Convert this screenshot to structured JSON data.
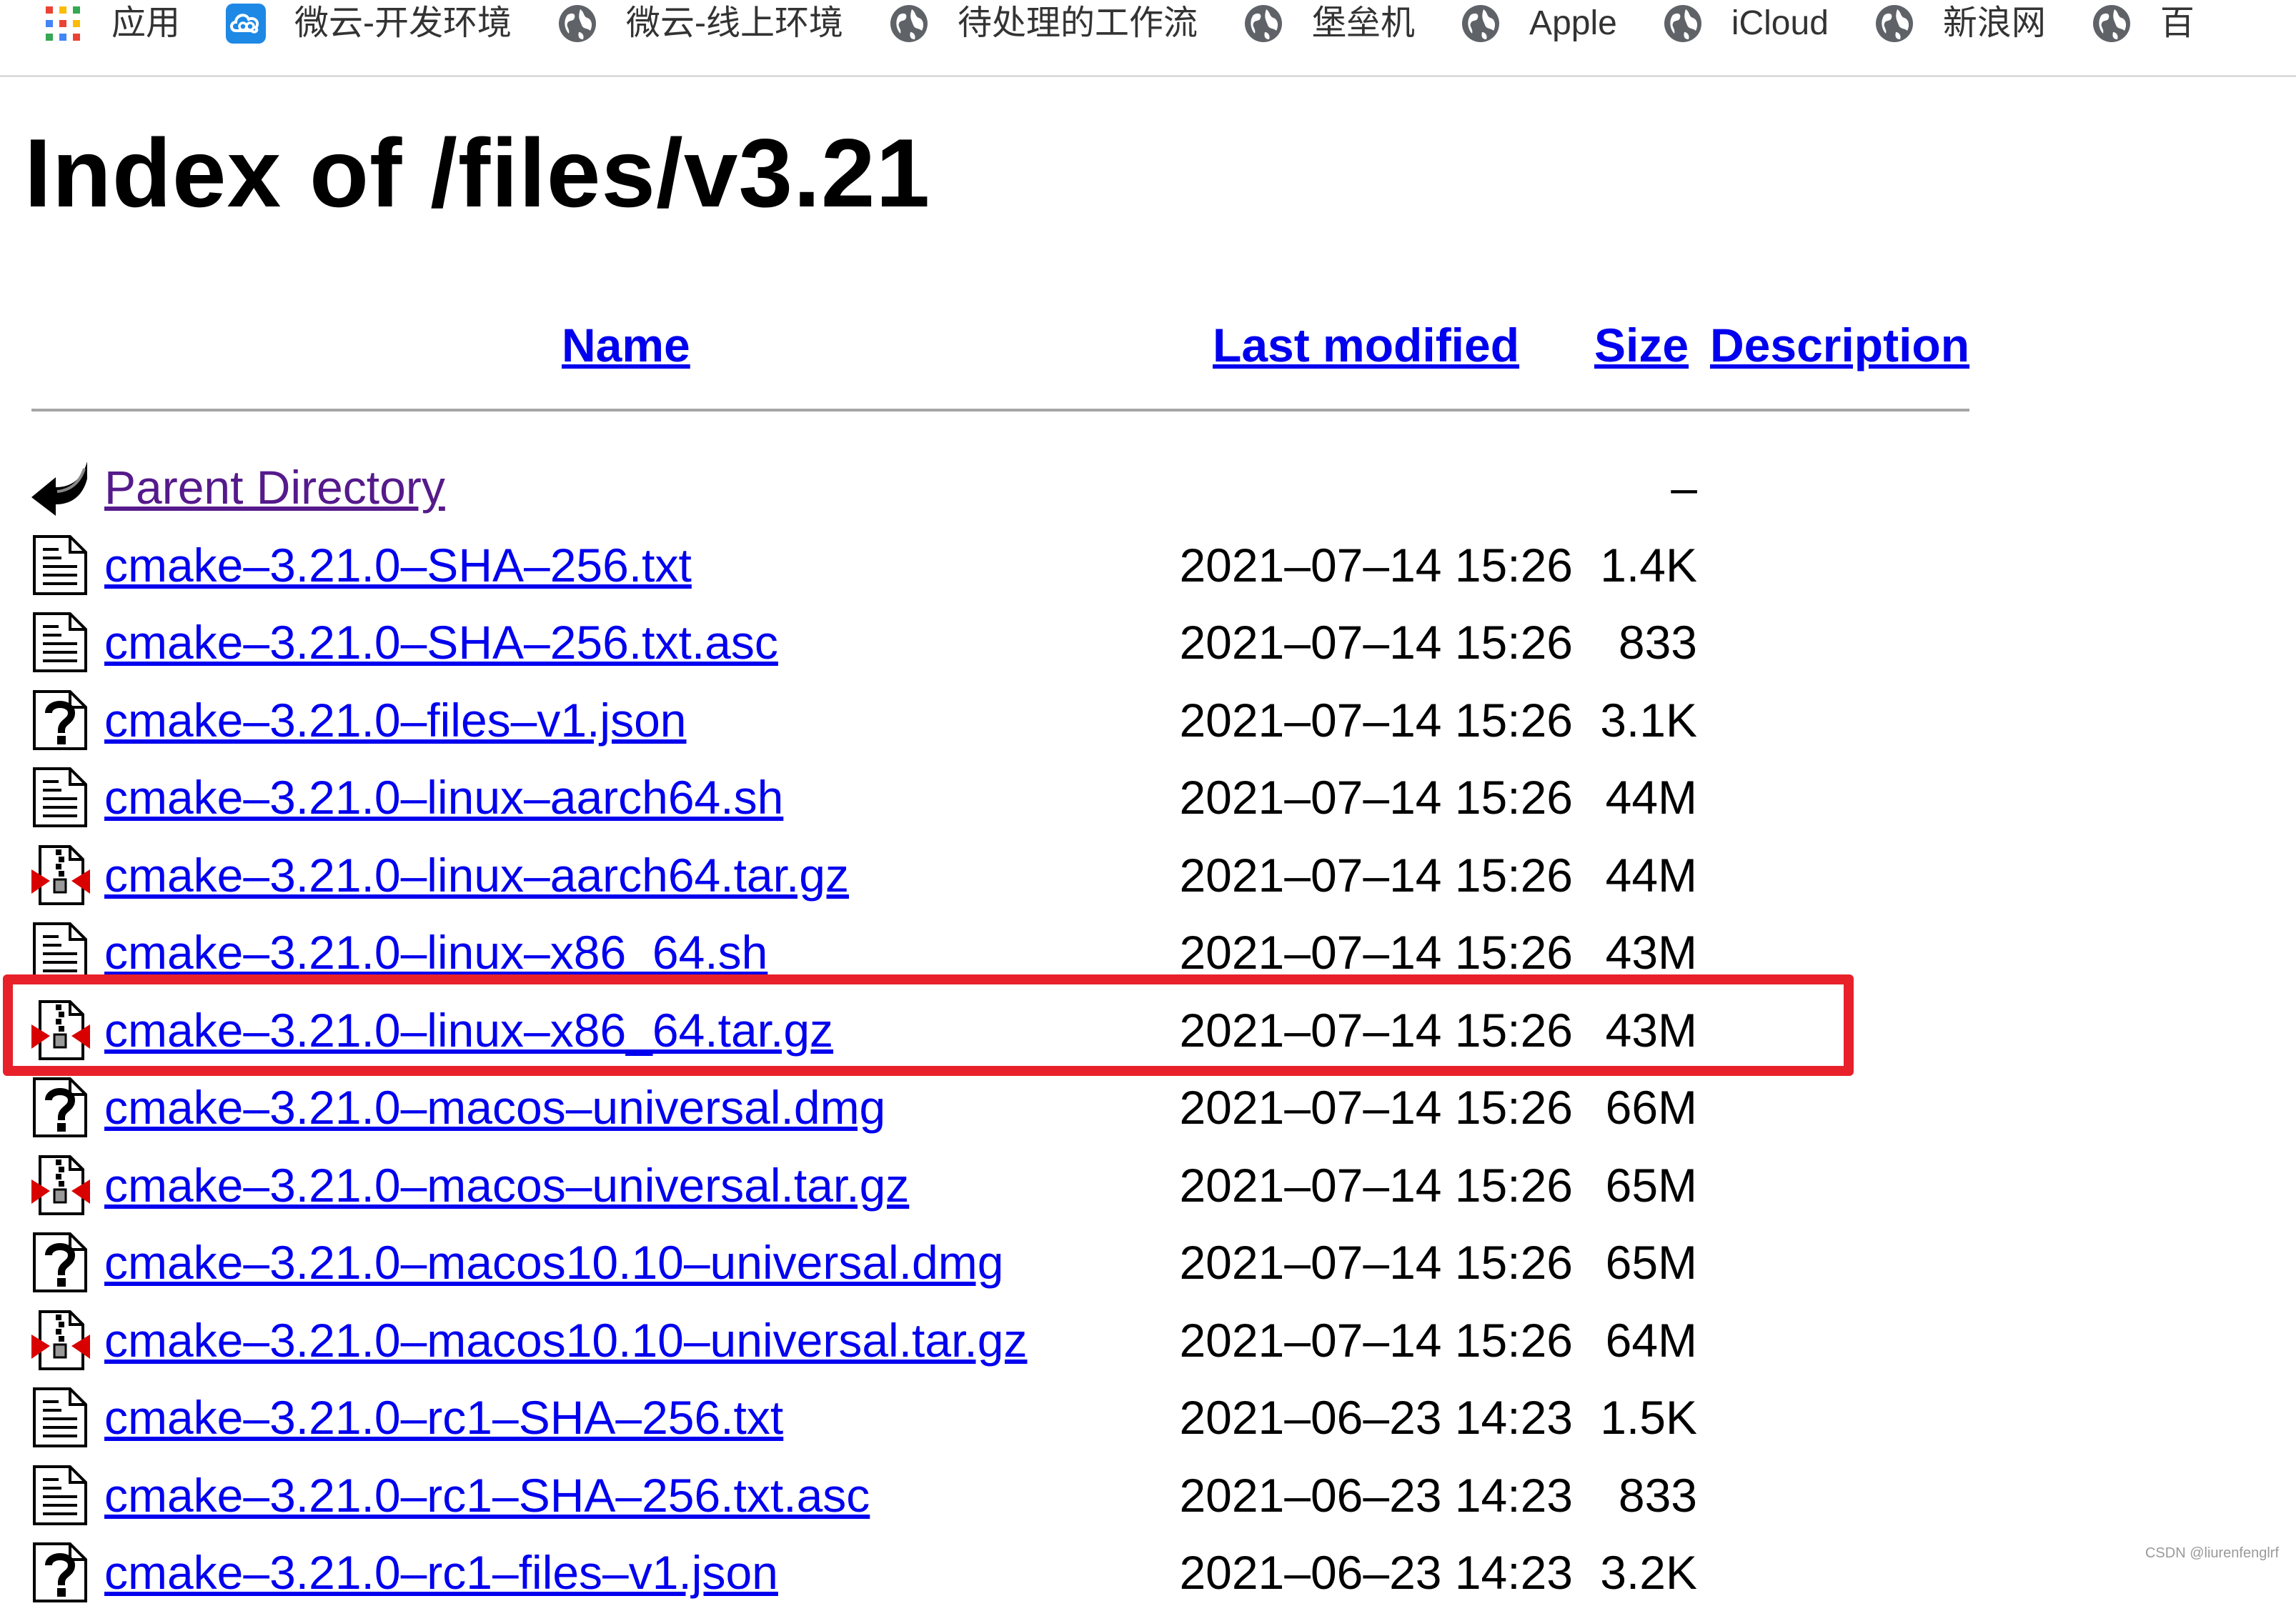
{
  "bookmarks": [
    {
      "label": "应用",
      "icon": "apps-grid-icon"
    },
    {
      "label": "微云-开发环境",
      "icon": "weiyun-cloud-icon"
    },
    {
      "label": "微云-线上环境",
      "icon": "globe-icon"
    },
    {
      "label": "待处理的工作流",
      "icon": "globe-icon"
    },
    {
      "label": "堡垒机",
      "icon": "globe-icon"
    },
    {
      "label": "Apple",
      "icon": "globe-icon"
    },
    {
      "label": "iCloud",
      "icon": "globe-icon"
    },
    {
      "label": "新浪网",
      "icon": "globe-icon"
    },
    {
      "label": "百",
      "icon": "globe-icon"
    }
  ],
  "page": {
    "title": "Index of /files/v3.21"
  },
  "columns": {
    "name": "Name",
    "last_modified": "Last modified",
    "size": "Size",
    "description": "Description"
  },
  "rows": [
    {
      "name": "Parent Directory",
      "date": "",
      "size": "–",
      "icon": "back-arrow-icon"
    },
    {
      "name": "cmake–3.21.0–SHA–256.txt",
      "date": "2021–07–14 15:26",
      "size": "1.4K",
      "icon": "text-file-icon"
    },
    {
      "name": "cmake–3.21.0–SHA–256.txt.asc",
      "date": "2021–07–14 15:26",
      "size": "833",
      "icon": "text-file-icon"
    },
    {
      "name": "cmake–3.21.0–files–v1.json",
      "date": "2021–07–14 15:26",
      "size": "3.1K",
      "icon": "unknown-file-icon"
    },
    {
      "name": "cmake–3.21.0–linux–aarch64.sh",
      "date": "2021–07–14 15:26",
      "size": "44M",
      "icon": "text-file-icon"
    },
    {
      "name": "cmake–3.21.0–linux–aarch64.tar.gz",
      "date": "2021–07–14 15:26",
      "size": "44M",
      "icon": "compressed-file-icon"
    },
    {
      "name": "cmake–3.21.0–linux–x86_64.sh",
      "date": "2021–07–14 15:26",
      "size": "43M",
      "icon": "text-file-icon"
    },
    {
      "name": "cmake–3.21.0–linux–x86_64.tar.gz",
      "date": "2021–07–14 15:26",
      "size": "43M",
      "icon": "compressed-file-icon"
    },
    {
      "name": "cmake–3.21.0–macos–universal.dmg",
      "date": "2021–07–14 15:26",
      "size": "66M",
      "icon": "unknown-file-icon"
    },
    {
      "name": "cmake–3.21.0–macos–universal.tar.gz",
      "date": "2021–07–14 15:26",
      "size": "65M",
      "icon": "compressed-file-icon"
    },
    {
      "name": "cmake–3.21.0–macos10.10–universal.dmg",
      "date": "2021–07–14 15:26",
      "size": "65M",
      "icon": "unknown-file-icon"
    },
    {
      "name": "cmake–3.21.0–macos10.10–universal.tar.gz",
      "date": "2021–07–14 15:26",
      "size": "64M",
      "icon": "compressed-file-icon"
    },
    {
      "name": "cmake–3.21.0–rc1–SHA–256.txt",
      "date": "2021–06–23 14:23",
      "size": "1.5K",
      "icon": "text-file-icon"
    },
    {
      "name": "cmake–3.21.0–rc1–SHA–256.txt.asc",
      "date": "2021–06–23 14:23",
      "size": "833",
      "icon": "text-file-icon"
    },
    {
      "name": "cmake–3.21.0–rc1–files–v1.json",
      "date": "2021–06–23 14:23",
      "size": "3.2K",
      "icon": "unknown-file-icon"
    }
  ],
  "highlighted_row": "cmake–3.21.0–linux–x86_64.tar.gz",
  "watermark": "CSDN @liurenfenglrf",
  "colors": {
    "link": "#0000ee",
    "visited_link": "#551a8b",
    "highlight": "#e8202a",
    "rule": "#a6a6a6"
  }
}
